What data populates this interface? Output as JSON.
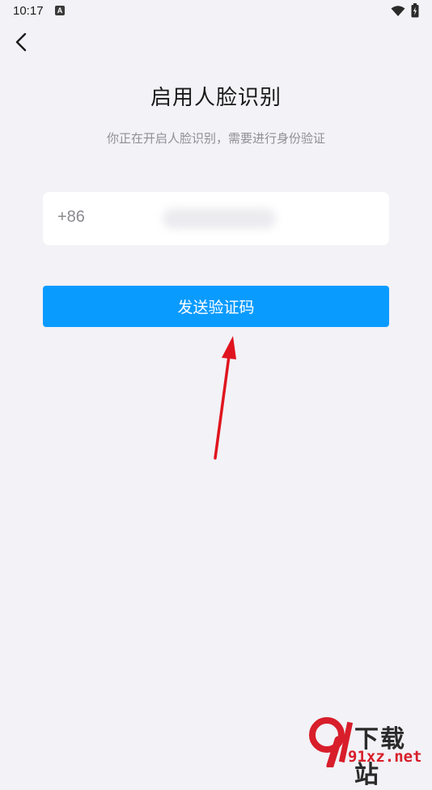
{
  "status_bar": {
    "time": "10:17",
    "app_icon_letter": "A"
  },
  "header": {
    "title": "启用人脸识别",
    "subtitle": "你正在开启人脸识别，需要进行身份验证"
  },
  "phone": {
    "country_code": "+86"
  },
  "actions": {
    "send_code_label": "发送验证码"
  },
  "watermark": {
    "logo_text": "9",
    "brand": "下载站",
    "url": "91xz.net"
  },
  "colors": {
    "background": "#f2f2f7",
    "accent": "#0a9bff",
    "annotation_arrow": "#e0141e",
    "watermark_red": "#d81e2a"
  },
  "icons": [
    "back-arrow-icon",
    "wifi-icon",
    "battery-icon",
    "annotation-arrow"
  ]
}
